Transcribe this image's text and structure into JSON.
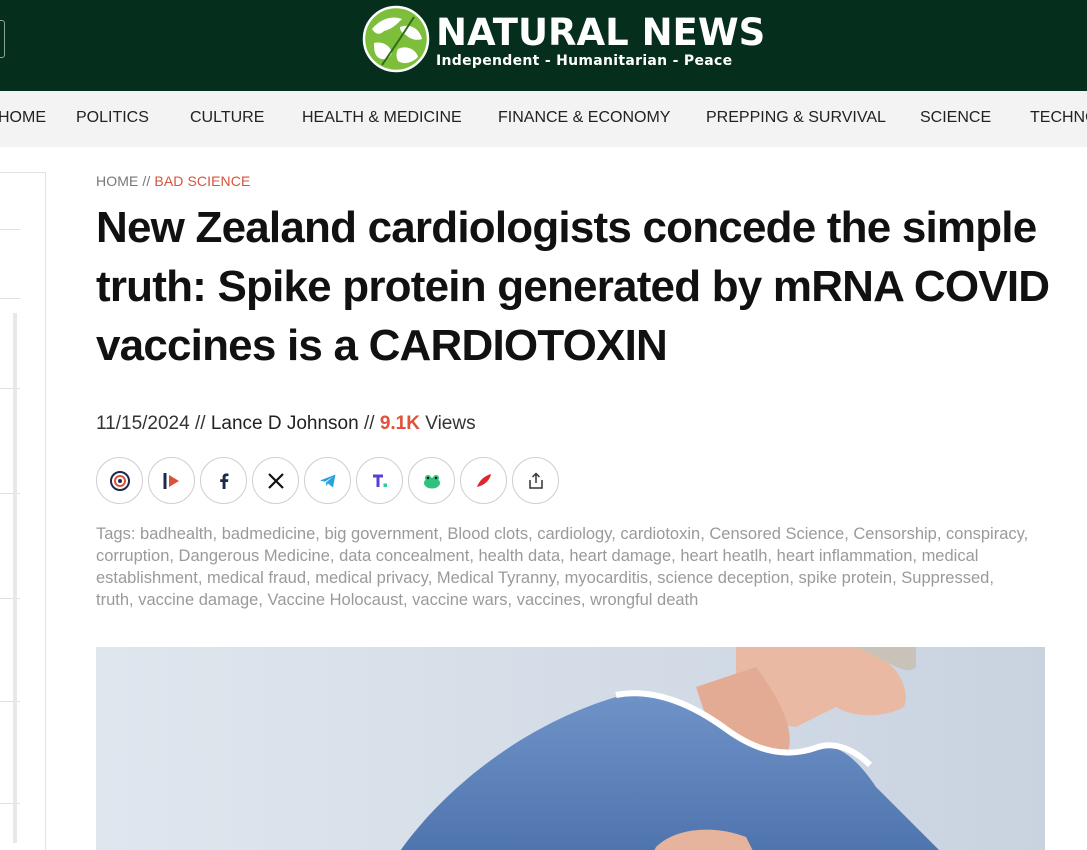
{
  "site": {
    "name": "NATURAL NEWS",
    "tagline": "Independent - Humanitarian - Peace"
  },
  "nav": {
    "items": [
      "HOME",
      "POLITICS",
      "CULTURE",
      "HEALTH & MEDICINE",
      "FINANCE & ECONOMY",
      "PREPPING & SURVIVAL",
      "SCIENCE",
      "TECHNO"
    ]
  },
  "breadcrumb": {
    "home": "HOME",
    "separator": "//",
    "category": "BAD SCIENCE"
  },
  "article": {
    "title": "New Zealand cardiologists concede the simple truth: Spike protein generated by mRNA COVID vaccines is a CARDIOTOXIN",
    "date": "11/15/2024",
    "meta_sep": "//",
    "author": "Lance D Johnson",
    "views_count": "9.1K",
    "views_label": "Views",
    "tags_label": "Tags:",
    "tags": [
      "badhealth",
      "badmedicine",
      "big government",
      "Blood clots",
      "cardiology",
      "cardiotoxin",
      "Censored Science",
      "Censorship",
      "conspiracy",
      "corruption",
      "Dangerous Medicine",
      "data concealment",
      "health data",
      "heart damage",
      "heart heatlh",
      "heart inflammation",
      "medical establishment",
      "medical fraud",
      "medical privacy",
      "Medical Tyranny",
      "myocarditis",
      "science deception",
      "spike protein",
      "Suppressed",
      "truth",
      "vaccine damage",
      "Vaccine Holocaust",
      "vaccine wars",
      "vaccines",
      "wrongful death"
    ]
  },
  "share_buttons": [
    {
      "icon": "brighteon-social-icon"
    },
    {
      "icon": "brighteon-video-icon"
    },
    {
      "icon": "facebook-icon"
    },
    {
      "icon": "x-icon"
    },
    {
      "icon": "telegram-icon"
    },
    {
      "icon": "truth-social-icon"
    },
    {
      "icon": "gab-frog-icon"
    },
    {
      "icon": "gettr-icon"
    },
    {
      "icon": "share-icon"
    }
  ],
  "colors": {
    "header_bg": "#052e1c",
    "nav_bg": "#f3f3f3",
    "accent": "#e0523b",
    "tag_text": "#9a9a9a"
  }
}
